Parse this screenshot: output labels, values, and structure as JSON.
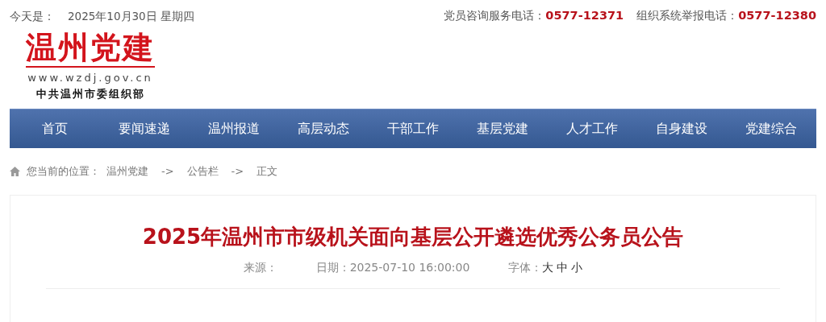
{
  "top_bar": {
    "date_label": "今天是：",
    "date": "2025年10月30日 星期四",
    "hotlines": [
      {
        "label": "党员咨询服务电话：",
        "number": "0577-12371"
      },
      {
        "label": "组织系统举报电话：",
        "number": "0577-12380"
      }
    ]
  },
  "logo": {
    "title": "温州党建",
    "url": "www.wzdj.gov.cn",
    "org": "中共温州市委组织部"
  },
  "nav": {
    "items": [
      {
        "label": "首页"
      },
      {
        "label": "要闻速递"
      },
      {
        "label": "温州报道"
      },
      {
        "label": "高层动态"
      },
      {
        "label": "干部工作"
      },
      {
        "label": "基层党建"
      },
      {
        "label": "人才工作"
      },
      {
        "label": "自身建设"
      },
      {
        "label": "党建综合"
      }
    ]
  },
  "breadcrumb": {
    "label": "您当前的位置：",
    "items": [
      {
        "label": "温州党建"
      },
      {
        "label": "公告栏"
      },
      {
        "label": "正文"
      }
    ],
    "separator": "->"
  },
  "article": {
    "title": "2025年温州市市级机关面向基层公开遴选优秀公务员公告",
    "source_label": "来源：",
    "date_label": "日期：",
    "date": "2025-07-10 16:00:00",
    "font_label": "字体：",
    "font_sizes": [
      {
        "label": "大"
      },
      {
        "label": "中"
      },
      {
        "label": "小"
      }
    ]
  }
}
